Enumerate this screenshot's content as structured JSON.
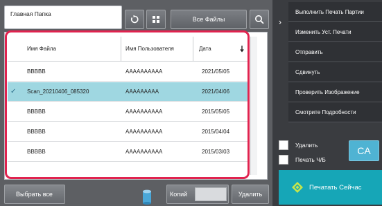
{
  "header": {
    "folder_title": "Главная Папка",
    "all_files_label": "Все Файлы"
  },
  "icons": {
    "refresh": "refresh-icon",
    "grid": "grid-view-icon",
    "search": "search-icon",
    "chevron": "chevron-right-icon",
    "start": "start-diamond-icon",
    "storage": "storage-cylinder-icon"
  },
  "table": {
    "columns": [
      "Имя Файла",
      "Имя Пользователя",
      "Дата"
    ],
    "rows": [
      {
        "file": "BBBBB",
        "user": "AAAAAAAAAA",
        "date": "2021/05/05",
        "selected": false
      },
      {
        "file": "Scan_20210406_085320",
        "user": "AAAAAAAAA",
        "date": "2021/04/06",
        "selected": true
      },
      {
        "file": "BBBBB",
        "user": "AAAAAAAAAA",
        "date": "2015/05/05",
        "selected": false
      },
      {
        "file": "BBBBB",
        "user": "AAAAAAAAAA",
        "date": "2015/04/04",
        "selected": false
      },
      {
        "file": "BBBBB",
        "user": "AAAAAAAAAA",
        "date": "2015/03/03",
        "selected": false
      }
    ]
  },
  "bottom": {
    "select_all_label": "Выбрать все",
    "copies_label": "Копий",
    "copies_value": "",
    "delete_label": "Удалить"
  },
  "actions": [
    "Выполнить Печать Партии",
    "Изменить Уст. Печати",
    "Отправить",
    "Сдвинуть",
    "Проверить Изображение",
    "Смотрите Подробности"
  ],
  "options": {
    "delete_label": "Удалить",
    "bw_label": "Печать Ч/Б",
    "ca_label": "CA",
    "start_label": "Печатать Сейчас"
  },
  "colors": {
    "highlight_frame": "#e0234f",
    "selected_row": "#9fd7e1",
    "start_button": "#16a6b7",
    "ca_button": "#4fb3d3"
  }
}
